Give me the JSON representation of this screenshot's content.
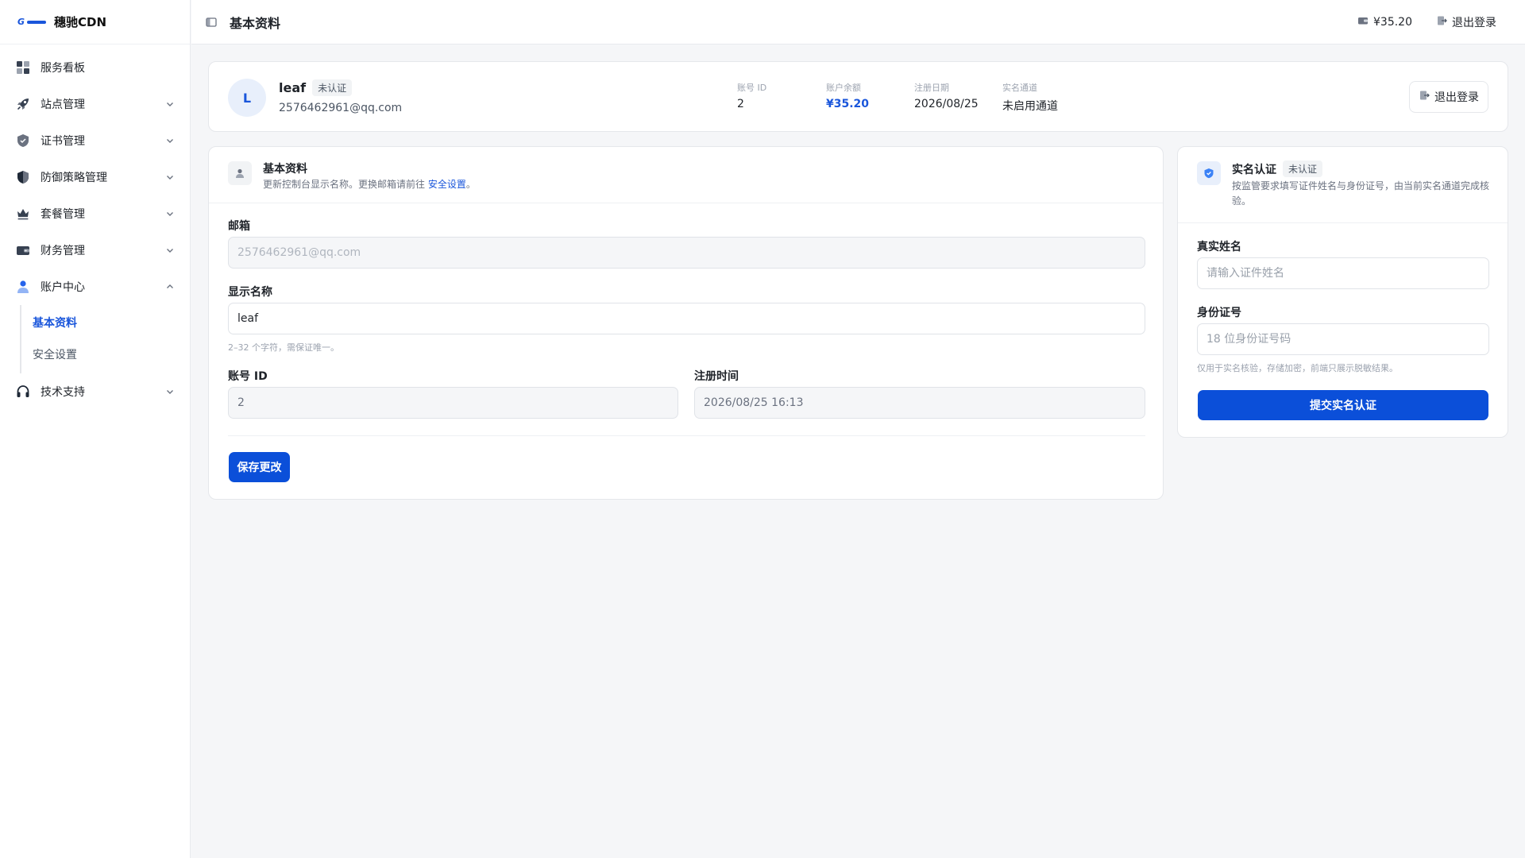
{
  "brand": {
    "name": "穗驰CDN",
    "logo_text": "G"
  },
  "sidebar": {
    "items": [
      {
        "label": "服务看板",
        "icon": "dashboard-icon",
        "expandable": false
      },
      {
        "label": "站点管理",
        "icon": "rocket-icon",
        "expandable": true
      },
      {
        "label": "证书管理",
        "icon": "shield-icon",
        "expandable": true
      },
      {
        "label": "防御策略管理",
        "icon": "shield-half-icon",
        "expandable": true
      },
      {
        "label": "套餐管理",
        "icon": "crown-icon",
        "expandable": true
      },
      {
        "label": "财务管理",
        "icon": "wallet-icon",
        "expandable": true
      },
      {
        "label": "账户中心",
        "icon": "user-icon",
        "expandable": true,
        "expanded": true
      },
      {
        "label": "技术支持",
        "icon": "headset-icon",
        "expandable": true
      }
    ],
    "account_sub": [
      {
        "label": "基本资料",
        "active": true
      },
      {
        "label": "安全设置",
        "active": false
      }
    ]
  },
  "header": {
    "title": "基本资料",
    "balance": "¥35.20",
    "logout": "退出登录"
  },
  "profile": {
    "avatar_letter": "L",
    "name": "leaf",
    "status_badge": "未认证",
    "email": "2576462961@qq.com",
    "stats": [
      {
        "key": "账号 ID",
        "value": "2",
        "highlight": false
      },
      {
        "key": "账户余额",
        "value": "¥35.20",
        "highlight": true
      },
      {
        "key": "注册日期",
        "value": "2026/08/25",
        "highlight": false
      },
      {
        "key": "实名通道",
        "value": "未启用通道",
        "highlight": false
      }
    ],
    "logout_label": "退出登录"
  },
  "basic": {
    "title": "基本资料",
    "desc_prefix": "更新控制台显示名称。更换邮箱请前往 ",
    "desc_link": "安全设置",
    "desc_suffix": "。",
    "email_label": "邮箱",
    "email_value": "2576462961@qq.com",
    "display_name_label": "显示名称",
    "display_name_value": "leaf",
    "display_name_hint": "2–32 个字符，需保证唯一。",
    "account_id_label": "账号 ID",
    "account_id_value": "2",
    "reg_time_label": "注册时间",
    "reg_time_value": "2026/08/25 16:13",
    "save_label": "保存更改"
  },
  "verify": {
    "title": "实名认证",
    "badge": "未认证",
    "desc": "按监管要求填写证件姓名与身份证号，由当前实名通道完成核验。",
    "name_label": "真实姓名",
    "name_placeholder": "请输入证件姓名",
    "id_label": "身份证号",
    "id_placeholder": "18 位身份证号码",
    "hint": "仅用于实名核验，存储加密，前端只展示脱敏结果。",
    "submit_label": "提交实名认证"
  },
  "colors": {
    "accent": "#1a56db",
    "button": "#0b4fd9",
    "background": "#f5f6f8"
  }
}
